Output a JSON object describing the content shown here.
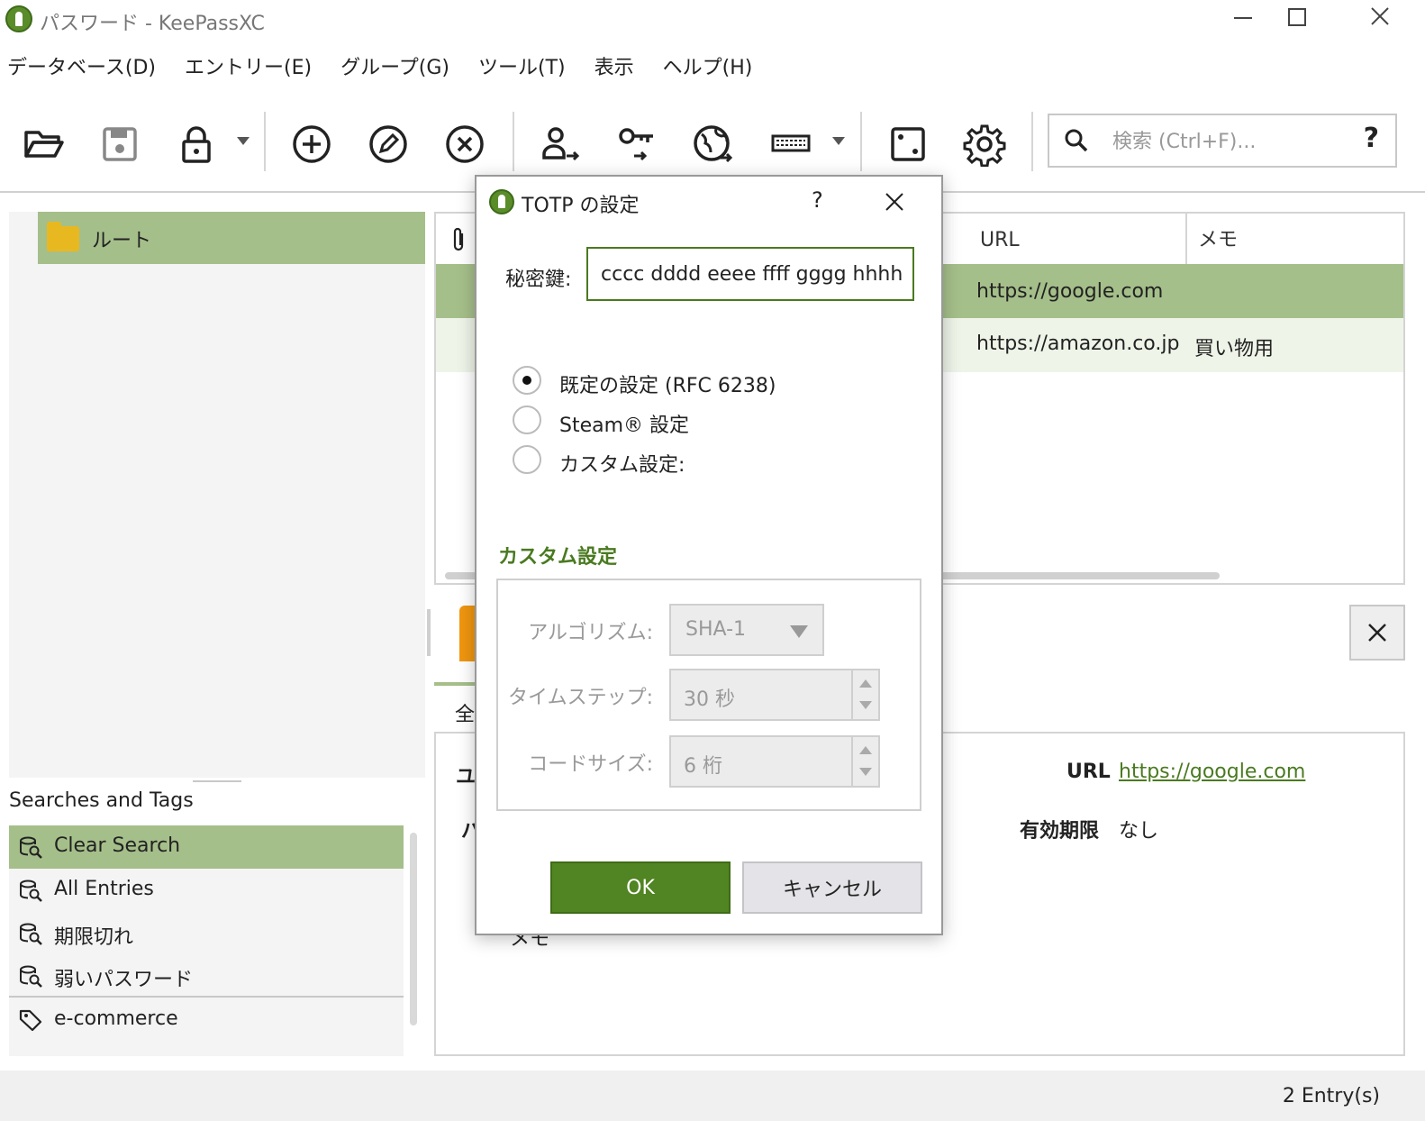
{
  "window": {
    "title": "パスワード - KeePassXC"
  },
  "menu": [
    "データベース(D)",
    "エントリー(E)",
    "グループ(G)",
    "ツール(T)",
    "表示",
    "ヘルプ(H)"
  ],
  "search": {
    "placeholder": "検索 (Ctrl+F)...",
    "help": "?"
  },
  "groups": {
    "root": "ルート"
  },
  "tags": {
    "title": "Searches and Tags",
    "items": [
      "Clear Search",
      "All Entries",
      "期限切れ",
      "弱いパスワード",
      "e-commerce"
    ]
  },
  "table": {
    "headers": {
      "url": "URL",
      "memo": "メモ"
    },
    "rows": [
      {
        "url": "https://google.com",
        "memo": ""
      },
      {
        "url": "https://amazon.co.jp",
        "memo": "買い物用"
      }
    ]
  },
  "preview": {
    "tab_partial": "全",
    "label_u_partial": "ユ",
    "label_p_partial": "パ",
    "label_memo_partial": "メモ",
    "url_label": "URL",
    "url_value": "https://google.com",
    "expiry_label": "有効期限",
    "expiry_value": "なし"
  },
  "status": {
    "entries": "2 Entry(s)"
  },
  "dialog": {
    "title": "TOTP の設定",
    "help": "?",
    "secret_label": "秘密鍵:",
    "secret_value": "cccc dddd eeee ffff gggg hhhh",
    "options": [
      "既定の設定 (RFC 6238)",
      "Steam® 設定",
      "カスタム設定:"
    ],
    "selected_option": 0,
    "custom_header": "カスタム設定",
    "algorithm_label": "アルゴリズム:",
    "algorithm_value": "SHA-1",
    "timestep_label": "タイムステップ:",
    "timestep_value": "30 秒",
    "codesize_label": "コードサイズ:",
    "codesize_value": "6 桁",
    "ok": "OK",
    "cancel": "キャンセル"
  },
  "colors": {
    "accent": "#518422",
    "selection": "#a5bf8a",
    "row_alt": "#eef4e8"
  }
}
